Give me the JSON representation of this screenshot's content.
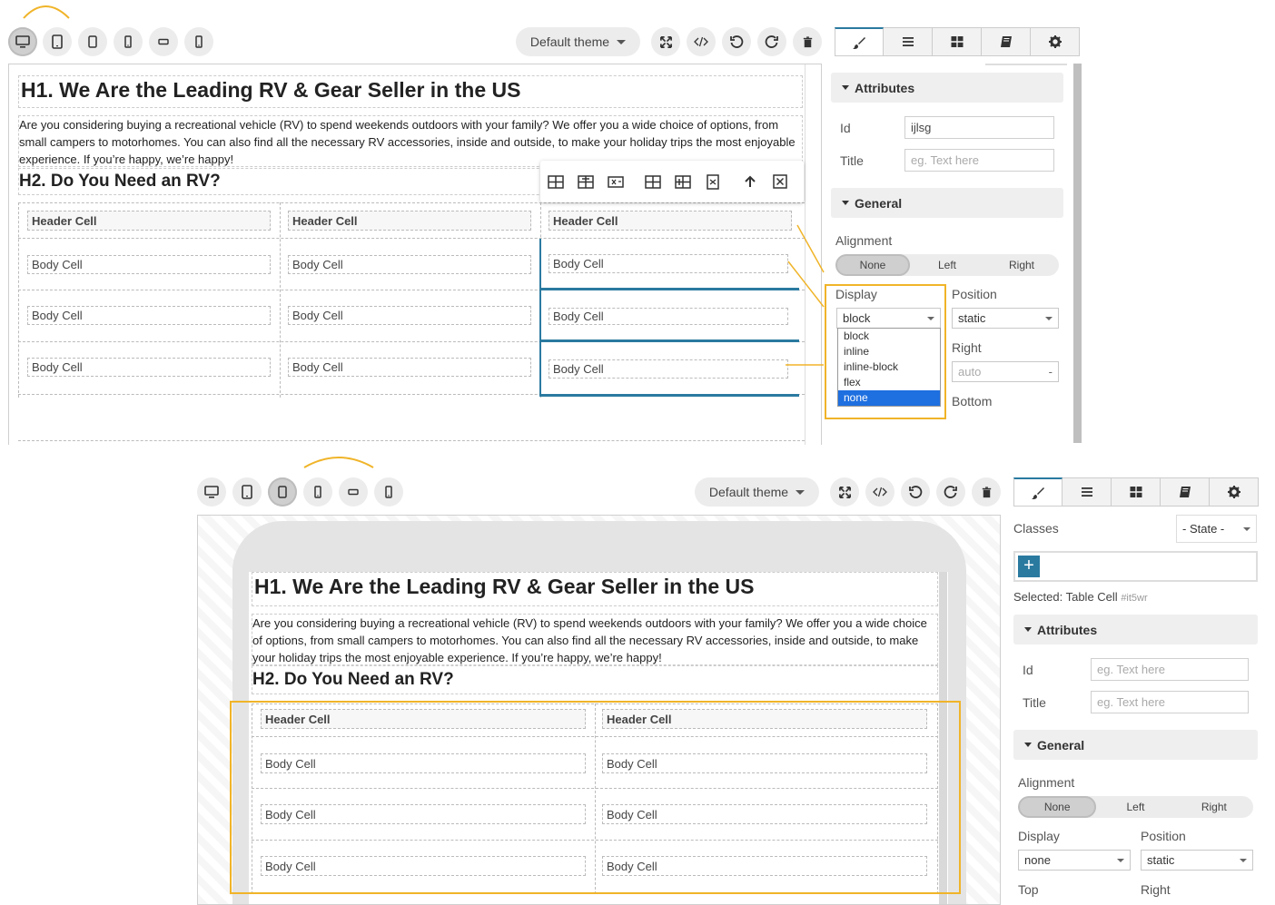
{
  "top": {
    "devices": [
      "desktop-icon",
      "tablet-icon",
      "tablet-small-icon",
      "mobile-icon",
      "mobile-landscape-icon",
      "mobile-portrait-icon"
    ],
    "theme_label": "Default theme",
    "actions": [
      "fullscreen-icon",
      "code-icon",
      "undo-icon",
      "redo-icon",
      "trash-icon"
    ],
    "tabs": [
      "brush-icon",
      "layers-icon",
      "blocks-icon",
      "book-icon",
      "gear-icon"
    ],
    "canvas": {
      "h1": "H1. We Are the Leading RV & Gear Seller in the US",
      "para": "Are you considering buying a recreational vehicle (RV) to spend weekends outdoors with your family? We offer you a wide choice of options, from small campers to motorhomes. You can also find all the necessary RV accessories, inside and outside, to make your holiday trips the most enjoyable experience. If you’re happy, we’re happy!",
      "h2": "H2. Do You Need an RV?",
      "header_cell": "Header Cell",
      "body_cell": "Body Cell"
    },
    "panel": {
      "attributes_label": "Attributes",
      "id_label": "Id",
      "id_value": "ijlsg",
      "title_label": "Title",
      "title_placeholder": "eg. Text here",
      "general_label": "General",
      "alignment_label": "Alignment",
      "alignment_options": [
        "None",
        "Left",
        "Right"
      ],
      "display_label": "Display",
      "display_value": "block",
      "display_options": [
        "block",
        "inline",
        "inline-block",
        "flex",
        "none"
      ],
      "display_selected": "none",
      "position_label": "Position",
      "position_value": "static",
      "right_label": "Right",
      "right_value": "auto",
      "right_unit": "-",
      "bottom_label": "Bottom"
    }
  },
  "bottom": {
    "theme_label": "Default theme",
    "canvas": {
      "h1": "H1. We Are the Leading RV & Gear Seller in the US",
      "para": "Are you considering buying a recreational vehicle (RV) to spend weekends outdoors with your family? We offer you a wide choice of options, from small campers to motorhomes. You can also find all the necessary RV accessories, inside and outside, to make your holiday trips the most enjoyable experience. If you’re happy, we’re happy!",
      "h2": "H2. Do You Need an RV?",
      "header_cell": "Header Cell",
      "body_cell": "Body Cell"
    },
    "panel": {
      "classes_label": "Classes",
      "state_value": "- State -",
      "add_label": "+",
      "selected_label": "Selected:",
      "selected_value": "Table Cell",
      "selected_id": "#it5wr",
      "attributes_label": "Attributes",
      "id_label": "Id",
      "id_placeholder": "eg. Text here",
      "title_label": "Title",
      "title_placeholder": "eg. Text here",
      "general_label": "General",
      "alignment_label": "Alignment",
      "alignment_options": [
        "None",
        "Left",
        "Right"
      ],
      "display_label": "Display",
      "display_value": "none",
      "position_label": "Position",
      "position_value": "static",
      "top_label": "Top",
      "right_label": "Right"
    }
  },
  "colors": {
    "accent": "#2a7aa0",
    "highlight": "#f0b429",
    "selected_option": "#1e6fe0"
  }
}
